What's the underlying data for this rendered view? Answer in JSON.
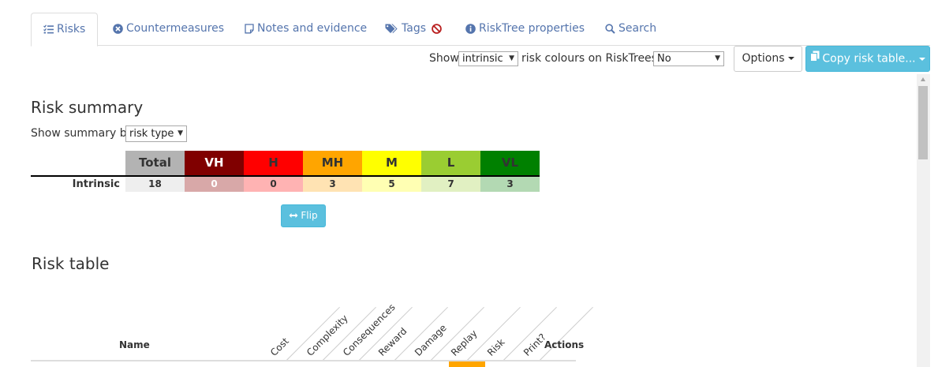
{
  "tabs": [
    {
      "label": "Risks",
      "icon": "tasks-icon",
      "active": true
    },
    {
      "label": "Countermeasures",
      "icon": "circle-x-icon",
      "active": false
    },
    {
      "label": "Notes and evidence",
      "icon": "note-icon",
      "active": false
    },
    {
      "label": "Tags",
      "icon": "tags-icon",
      "active": false
    },
    {
      "label": "RiskTree properties",
      "icon": "info-icon",
      "active": false
    },
    {
      "label": "Search",
      "icon": "search-icon",
      "active": false
    }
  ],
  "toolbar": {
    "show_label": "Show",
    "colour_type_value": "intrinsic",
    "colours_label": "risk colours on RiskTrees?",
    "colours_value": "No",
    "options_label": "Options",
    "copy_label": "Copy risk table..."
  },
  "summary": {
    "title": "Risk summary",
    "show_by_label": "Show summary by",
    "show_by_value": "risk type",
    "columns": [
      {
        "label": "Total",
        "header_bg": "#b3b3b3",
        "header_fg": "#333333",
        "cell_bg": "#eeeeee",
        "cell_fg": "#333333"
      },
      {
        "label": "VH",
        "header_bg": "#800000",
        "header_fg": "#ffffff",
        "cell_bg": "#d8a8a8",
        "cell_fg": "#ffffff"
      },
      {
        "label": "H",
        "header_bg": "#ff0000",
        "header_fg": "#333333",
        "cell_bg": "#ffb3b3",
        "cell_fg": "#333333"
      },
      {
        "label": "MH",
        "header_bg": "#ffa500",
        "header_fg": "#333333",
        "cell_bg": "#ffe3b3",
        "cell_fg": "#333333"
      },
      {
        "label": "M",
        "header_bg": "#ffff00",
        "header_fg": "#333333",
        "cell_bg": "#ffffb3",
        "cell_fg": "#333333"
      },
      {
        "label": "L",
        "header_bg": "#9acd32",
        "header_fg": "#333333",
        "cell_bg": "#e1f0c2",
        "cell_fg": "#333333"
      },
      {
        "label": "VL",
        "header_bg": "#008000",
        "header_fg": "#333333",
        "cell_bg": "#b3d9b3",
        "cell_fg": "#333333"
      }
    ],
    "rows": [
      {
        "label": "Intrinsic",
        "values": [
          "18",
          "0",
          "0",
          "3",
          "5",
          "7",
          "3"
        ]
      }
    ],
    "flip_label": "Flip"
  },
  "risk_table": {
    "title": "Risk table",
    "name_header": "Name",
    "rotated_headers": [
      "Cost",
      "Complexity",
      "Consequences",
      "Reward",
      "Damage",
      "Replay",
      "Risk",
      "Print?"
    ],
    "actions_header": "Actions",
    "risk_mark_color": "#ffa500"
  }
}
